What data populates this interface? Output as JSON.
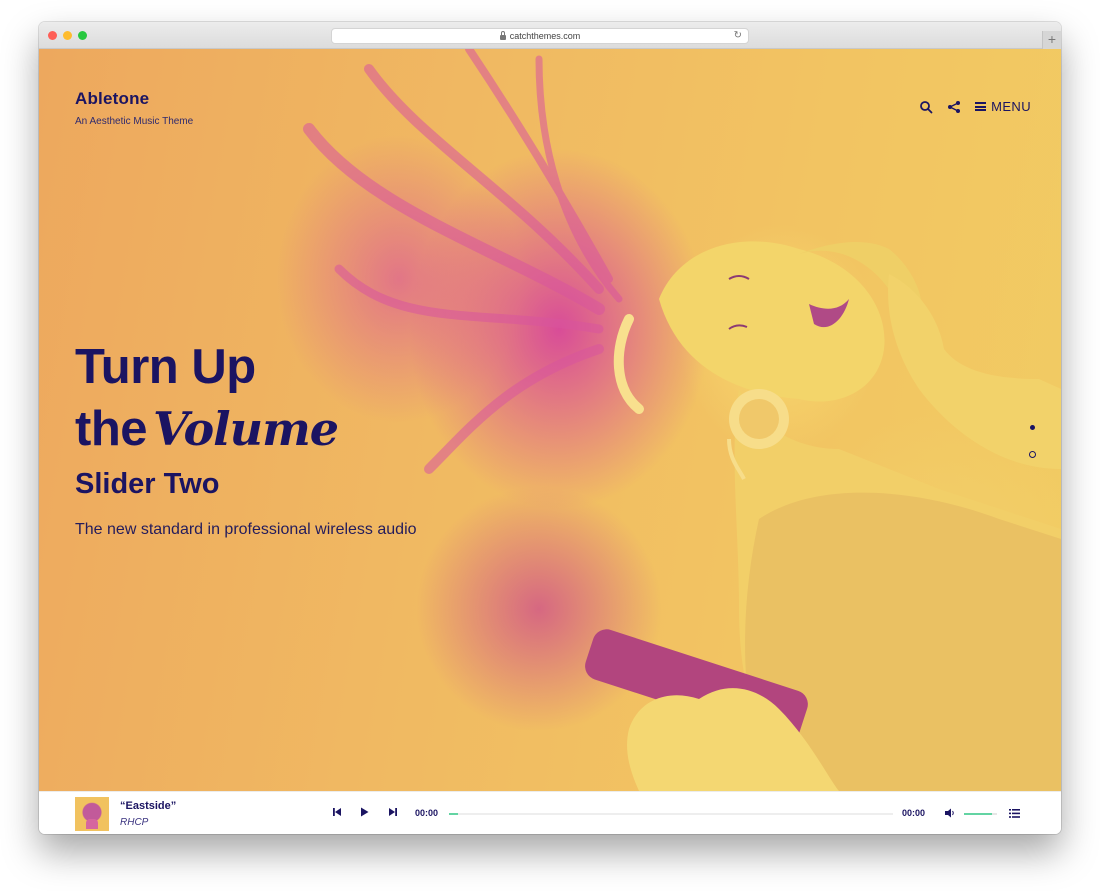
{
  "browser": {
    "url": "catchthemes.com",
    "new_tab_symbol": "+"
  },
  "site": {
    "title": "Abletone",
    "tagline": "An Aesthetic Music Theme"
  },
  "header": {
    "menu_label": "MENU",
    "icons": [
      "search-icon",
      "share-icon",
      "hamburger-icon"
    ]
  },
  "slide": {
    "headline_line1": "Turn Up",
    "headline_line2_word": "the",
    "headline_script_word": "Volume",
    "subtitle": "Slider Two",
    "description": "The new standard in professional wireless audio",
    "dots_total": 2,
    "active_dot": 1
  },
  "player": {
    "track_title": "“Eastside”",
    "artist": "RHCP",
    "current_time": "00:00",
    "duration": "00:00",
    "progress_fraction": 0.02,
    "volume_fraction": 0.85
  },
  "colors": {
    "navy": "#1b1462",
    "hero_orange": "#eda85e",
    "hero_yellow": "#f1cc63",
    "magenta": "#d7469b",
    "accent_green": "#63d4a3"
  }
}
